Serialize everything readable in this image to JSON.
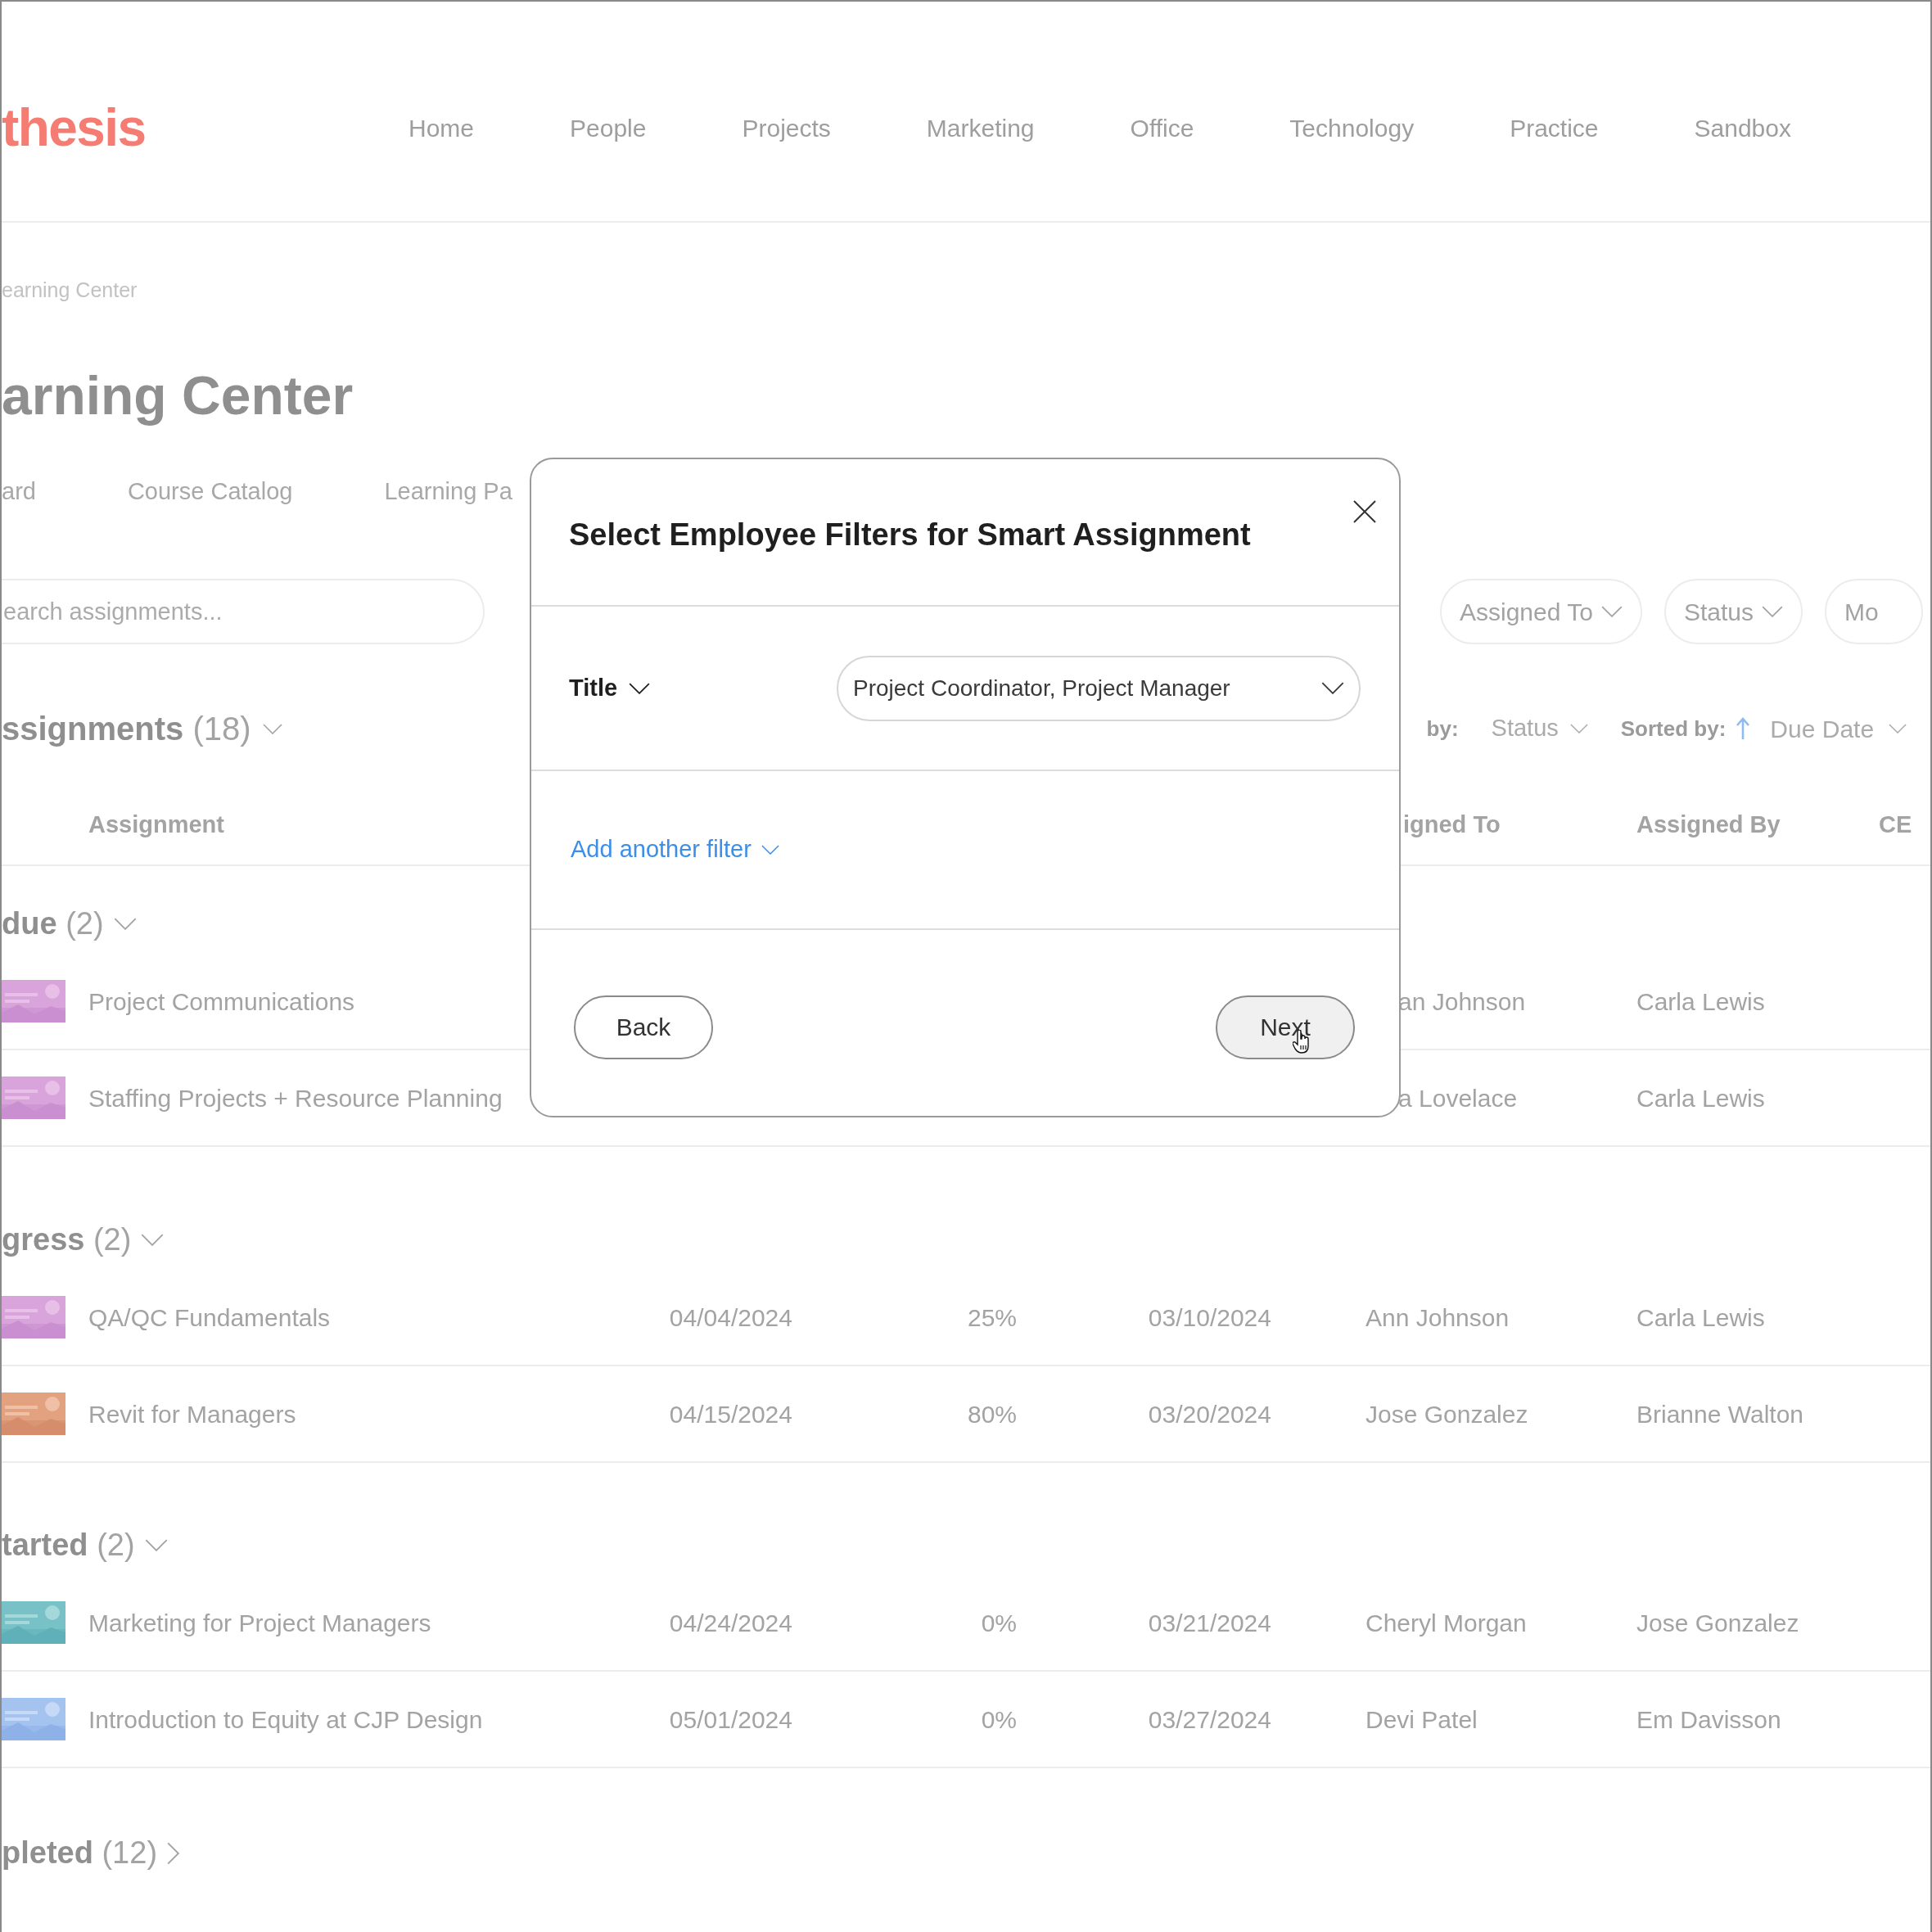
{
  "logo": "thesis",
  "nav": [
    "Home",
    "People",
    "Projects",
    "Marketing",
    "Office",
    "Technology",
    "Practice",
    "Sandbox"
  ],
  "breadcrumb": "earning Center",
  "page_title": "arning Center",
  "tabs": [
    "ard",
    "Course Catalog",
    "Learning Pa"
  ],
  "search": {
    "placeholder": "earch assignments..."
  },
  "filters": [
    {
      "label": "Assigned To",
      "dropdown": true
    },
    {
      "label": "Status",
      "dropdown": true
    },
    {
      "label": "Mo",
      "dropdown": false
    }
  ],
  "list_heading": {
    "label": "ssignments",
    "count": "(18)"
  },
  "group_by": {
    "label": "by:",
    "value": "Status"
  },
  "sort": {
    "label": "Sorted by:",
    "ascending": true,
    "value": "Due Date"
  },
  "columns": [
    "Assignment",
    "igned To",
    "Assigned By",
    "CE"
  ],
  "groups": [
    {
      "label": "due",
      "count": "(2)",
      "expanded": true,
      "rows": [
        {
          "name": "Project Communications",
          "assigned_to": "an Johnson",
          "assigned_by": "Carla Lewis"
        },
        {
          "name": "Staffing Projects + Resource Planning",
          "assigned_to": "a Lovelace",
          "assigned_by": "Carla Lewis"
        }
      ]
    },
    {
      "label": "gress",
      "count": "(2)",
      "expanded": true,
      "rows": [
        {
          "name": "QA/QC Fundamentals",
          "due": "04/04/2024",
          "progress": "25%",
          "assigned_date": "03/10/2024",
          "assigned_to": "Ann Johnson",
          "assigned_by": "Carla Lewis"
        },
        {
          "name": "Revit for Managers",
          "due": "04/15/2024",
          "progress": "80%",
          "assigned_date": "03/20/2024",
          "assigned_to": "Jose Gonzalez",
          "assigned_by": "Brianne Walton"
        }
      ]
    },
    {
      "label": "tarted",
      "count": "(2)",
      "expanded": true,
      "rows": [
        {
          "name": "Marketing for Project Managers",
          "due": "04/24/2024",
          "progress": "0%",
          "assigned_date": "03/21/2024",
          "assigned_to": "Cheryl Morgan",
          "assigned_by": "Jose Gonzalez"
        },
        {
          "name": "Introduction to Equity at CJP Design",
          "due": "05/01/2024",
          "progress": "0%",
          "assigned_date": "03/27/2024",
          "assigned_to": "Devi Patel",
          "assigned_by": "Em Davisson"
        }
      ]
    },
    {
      "label": "pleted",
      "count": "(12)",
      "expanded": false
    }
  ],
  "modal": {
    "title": "Select Employee Filters for Smart Assignment",
    "filters": [
      {
        "field": "Title",
        "value": "Project Coordinator, Project Manager"
      }
    ],
    "add_filter": "Add another filter",
    "buttons": [
      {
        "label": "Back",
        "hovered": false
      },
      {
        "label": "Next",
        "hovered": true
      }
    ]
  }
}
